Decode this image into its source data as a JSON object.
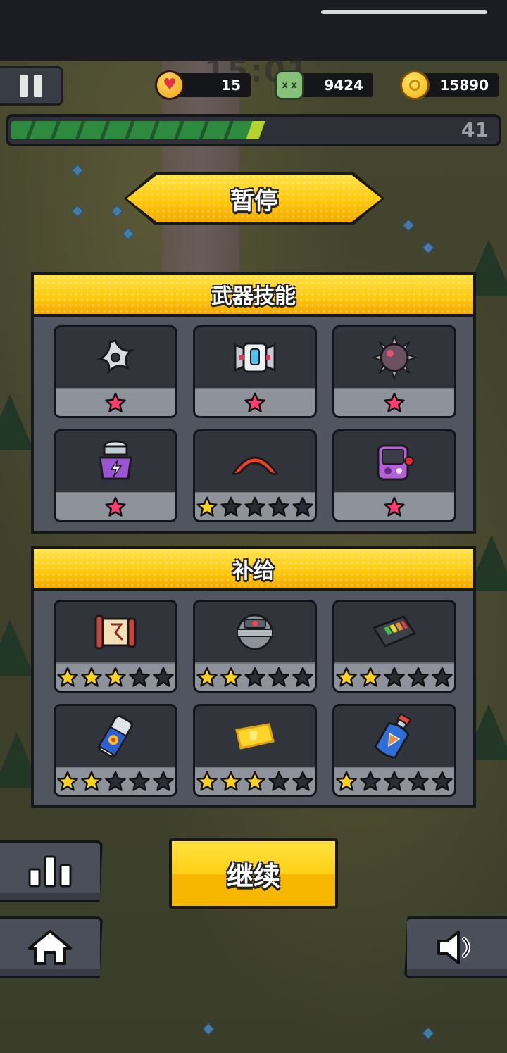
{
  "hud": {
    "timer_ghost": "15:01",
    "lives": "15",
    "kills": "9424",
    "coins": "15890",
    "level": "41",
    "xp_progress": 0.58
  },
  "pause_title": "暂停",
  "weapons": {
    "title": "武器技能",
    "items": [
      {
        "icon": "shuriken-icon",
        "stars": 1,
        "max_stars": 1,
        "star_color": "#ff3d6e"
      },
      {
        "icon": "drone-robot-icon",
        "stars": 1,
        "max_stars": 1,
        "star_color": "#ff3d6e"
      },
      {
        "icon": "spiked-mine-icon",
        "stars": 1,
        "max_stars": 1,
        "star_color": "#ff3d6e"
      },
      {
        "icon": "lightning-tower-icon",
        "stars": 1,
        "max_stars": 1,
        "star_color": "#ff3d6e"
      },
      {
        "icon": "boomerang-icon",
        "stars": 1,
        "max_stars": 5,
        "star_color": "#ffd21e"
      },
      {
        "icon": "game-console-icon",
        "stars": 1,
        "max_stars": 1,
        "star_color": "#ff3d6e"
      }
    ]
  },
  "supplies": {
    "title": "补给",
    "items": [
      {
        "icon": "scroll-icon",
        "stars": 3,
        "max_stars": 5
      },
      {
        "icon": "energy-core-icon",
        "stars": 2,
        "max_stars": 5
      },
      {
        "icon": "battery-pack-icon",
        "stars": 2,
        "max_stars": 5
      },
      {
        "icon": "energy-drink-icon",
        "stars": 2,
        "max_stars": 5
      },
      {
        "icon": "gold-ticket-icon",
        "stars": 3,
        "max_stars": 5
      },
      {
        "icon": "potion-bottle-icon",
        "stars": 1,
        "max_stars": 5
      }
    ]
  },
  "continue_label": "继续",
  "colors": {
    "accent_yellow": "#ffc80a",
    "star_gold": "#ffd21e",
    "star_empty": "#2a2d34",
    "star_pink": "#ff3d6e",
    "panel_bg": "#50555f"
  }
}
